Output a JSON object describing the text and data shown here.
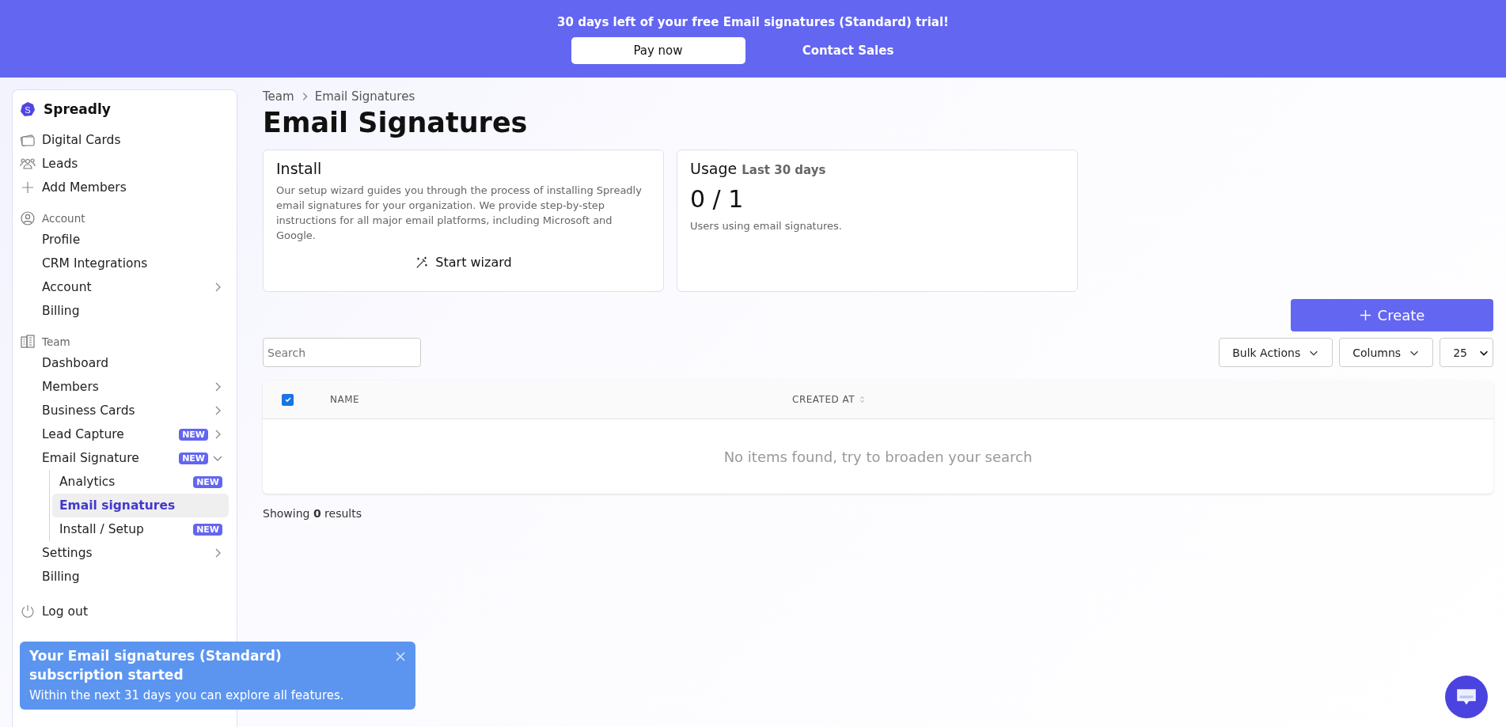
{
  "banner": {
    "message": "30 days left of your free Email signatures (Standard) trial!",
    "buttons": [
      {
        "label": "Pay now",
        "kind": "primary"
      },
      {
        "label": "Contact Sales",
        "kind": "link"
      }
    ]
  },
  "sidebar": {
    "brand": "Spreadly",
    "logo_letter": "S",
    "top_items": [
      {
        "label": "Digital Cards"
      },
      {
        "label": "Leads"
      },
      {
        "label": "Add Members"
      }
    ],
    "sections": [
      {
        "title": "Account",
        "items": [
          {
            "label": "Profile",
            "selected": false
          },
          {
            "label": "CRM Integrations",
            "selected": false
          },
          {
            "label": "Account",
            "selected": false,
            "expanded": false
          },
          {
            "label": "Billing",
            "selected": false
          }
        ]
      },
      {
        "title": "Team",
        "items": [
          {
            "label": "Dashboard",
            "selected": false
          },
          {
            "label": "Members",
            "selected": false,
            "expanded": false
          },
          {
            "label": "Business Cards",
            "selected": false,
            "expanded": false
          },
          {
            "label": "Lead Capture",
            "badge": "NEW",
            "selected": false,
            "expanded": false
          },
          {
            "label": "Email Signature",
            "badge": "NEW",
            "selected": false,
            "expanded": true,
            "children": [
              {
                "label": "Analytics",
                "badge": "NEW",
                "selected": false
              },
              {
                "label": "Email signatures",
                "selected": true
              },
              {
                "label": "Install / Setup",
                "badge": "NEW",
                "selected": false
              }
            ]
          },
          {
            "label": "Settings",
            "selected": false,
            "expanded": false
          },
          {
            "label": "Billing",
            "selected": false
          }
        ]
      }
    ],
    "logout": "Log out"
  },
  "breadcrumb": [
    "Team",
    "Email Signatures"
  ],
  "title": "Email Signatures",
  "install_card": {
    "title": "Install",
    "text": "Our setup wizard guides you through the process of installing Spreadly email signatures for your organization. We provide step-by-step instructions for all major email platforms, including Microsoft and Google.",
    "button": "Start wizard"
  },
  "usage_card": {
    "title": "Usage",
    "subtitle": "Last 30 days",
    "value": "0 / 1",
    "caption": "Users using email signatures."
  },
  "create_button": "Create",
  "search": {
    "placeholder": "Search"
  },
  "toolbar": {
    "buttons": [
      "Bulk Actions",
      "Columns"
    ],
    "page_size": "25"
  },
  "table": {
    "select_all_checked": true,
    "columns": [
      {
        "label": "NAME",
        "sortable": false
      },
      {
        "label": "CREATED AT",
        "sortable": true
      }
    ],
    "empty_message": "No items found, try to broaden your search"
  },
  "results": "Showing **0** results",
  "toast": {
    "title": "Your Email signatures (Standard) subscription started",
    "message": "Within the next 31 days you can explore all features."
  }
}
